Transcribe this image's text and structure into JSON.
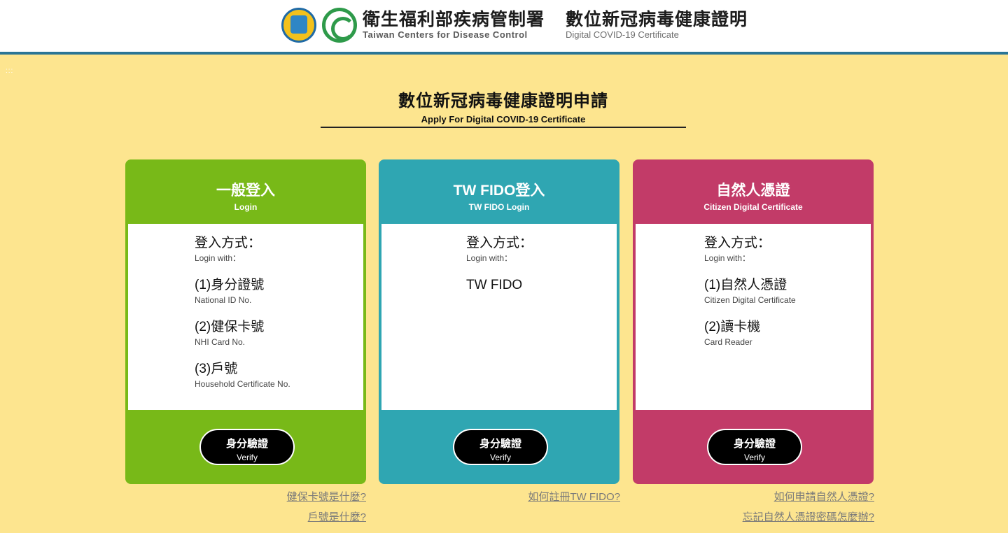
{
  "header": {
    "agency_zh": "衛生福利部疾病管制署",
    "agency_en": "Taiwan Centers for Disease Control",
    "cert_zh": "數位新冠病毒健康證明",
    "cert_en": "Digital COVID-19 Certificate"
  },
  "dots": ":::",
  "page": {
    "title_zh": "數位新冠病毒健康證明申請",
    "title_en": "Apply For Digital COVID-19 Certificate"
  },
  "colors": {
    "general": "#78b918",
    "fido": "#2fa6b2",
    "citizen": "#c23b68",
    "background": "#fde58f",
    "header_rule": "#2a7596"
  },
  "cards": {
    "general": {
      "title_zh": "一般登入",
      "title_en": "Login",
      "login_zh": "登入方式：",
      "login_en": "Login with：",
      "items": [
        {
          "zh": "(1)身分證號",
          "en": "National ID No."
        },
        {
          "zh": "(2)健保卡號",
          "en": "NHI Card No."
        },
        {
          "zh": "(3)戶號",
          "en": "Household Certificate No."
        }
      ],
      "button_zh": "身分驗證",
      "button_en": "Verify"
    },
    "fido": {
      "title_zh": "TW FIDO登入",
      "title_en": "TW FIDO Login",
      "login_zh": "登入方式：",
      "login_en": "Login with：",
      "items": [
        {
          "zh": "TW FIDO"
        }
      ],
      "button_zh": "身分驗證",
      "button_en": "Verify"
    },
    "citizen": {
      "title_zh": "自然人憑證",
      "title_en": "Citizen Digital Certificate",
      "login_zh": "登入方式：",
      "login_en": "Login with：",
      "items": [
        {
          "zh": "(1)自然人憑證",
          "en": "Citizen Digital Certificate"
        },
        {
          "zh": "(2)讀卡機",
          "en": "Card Reader"
        }
      ],
      "button_zh": "身分驗證",
      "button_en": "Verify"
    }
  },
  "links": {
    "general": [
      "健保卡號是什麼?",
      "戶號是什麼?"
    ],
    "fido": [
      "如何註冊TW FIDO?"
    ],
    "citizen": [
      "如何申請自然人憑證?",
      "忘記自然人憑證密碼怎麼辦?"
    ]
  }
}
